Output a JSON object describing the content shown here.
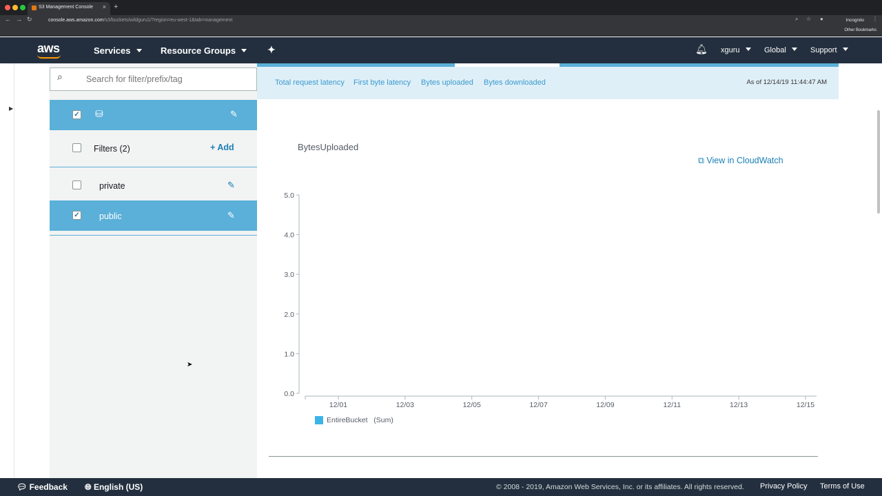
{
  "browser": {
    "tab_title": "S3 Management Console",
    "new_tab": "+",
    "url_host": "console.aws.amazon.com",
    "url_path": "/s3/buckets/wildguru1/?region=eu-west-1&tab=management",
    "profile": "Incognito",
    "bookmarks": "Other Bookmarks"
  },
  "nav": {
    "logo": "aws",
    "services": "Services",
    "resource_groups": "Resource Groups",
    "user": "xguru",
    "region": "Global",
    "support": "Support"
  },
  "sidebar": {
    "search_placeholder": "Search for filter/prefix/tag",
    "filters_label": "Filters (2)",
    "add_label": "Add",
    "items": [
      {
        "label": "private",
        "checked": false
      },
      {
        "label": "public",
        "checked": true
      }
    ]
  },
  "metrics": {
    "tabs": [
      "Total request latency",
      "First byte latency",
      "Bytes uploaded",
      "Bytes downloaded"
    ],
    "as_of": "As of 12/14/19 11:44:47 AM",
    "view_in_cloudwatch": "View in CloudWatch"
  },
  "chart_data": {
    "type": "line",
    "title": "BytesUploaded",
    "xlabel": "",
    "ylabel": "",
    "x_tick_labels": [
      "12/01",
      "12/03",
      "12/05",
      "12/07",
      "12/09",
      "12/11",
      "12/13",
      "12/15"
    ],
    "y_tick_labels": [
      "5.0",
      "4.0",
      "3.0",
      "2.0",
      "1.0",
      "0.0"
    ],
    "ylim": [
      0,
      5
    ],
    "series": [
      {
        "name": "EntireBucket",
        "stat": "(Sum)",
        "values": []
      }
    ],
    "legend": "bottom-left",
    "grid": false,
    "colors": {
      "series": "#3cb4e6"
    }
  },
  "footer": {
    "feedback": "Feedback",
    "language": "English (US)",
    "copyright": "© 2008 - 2019, Amazon Web Services, Inc. or its affiliates. All rights reserved.",
    "privacy": "Privacy Policy",
    "terms": "Terms of Use"
  },
  "colors": {
    "nav_bg": "#232f3e",
    "accent": "#5ab0d8",
    "link": "#1a7fb5",
    "brand": "#ff9900"
  }
}
